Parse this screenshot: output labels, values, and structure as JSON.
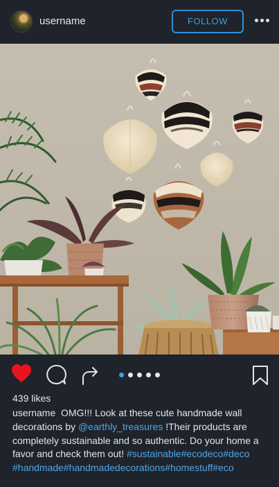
{
  "header": {
    "username": "username",
    "follow_label": "FOLLOW",
    "more_icon": "more-horizontal-icon"
  },
  "post": {
    "photo_description_icon": "post-photo",
    "likes": "439 likes",
    "carousel": {
      "total": 5,
      "active": 1
    },
    "caption": {
      "username": "username",
      "text_before_mention": "OMG!!! Look at these cute handmade wall decorations by",
      "mention": "@earthly_treasures",
      "text_after_mention": "!Their products are completely sustainable and so authentic. Do your home a favor and check them out!",
      "hashtags": "#sustainable#ecodeco#deco #handmade#handmadedecorations#homestuff#eco"
    }
  },
  "icons": {
    "like": "heart-icon",
    "comment": "comment-icon",
    "share": "share-icon",
    "save": "bookmark-icon"
  },
  "colors": {
    "background": "#1f232b",
    "accent": "#2c8fd6",
    "like": "#e8141e",
    "text": "#e4e6ea"
  }
}
